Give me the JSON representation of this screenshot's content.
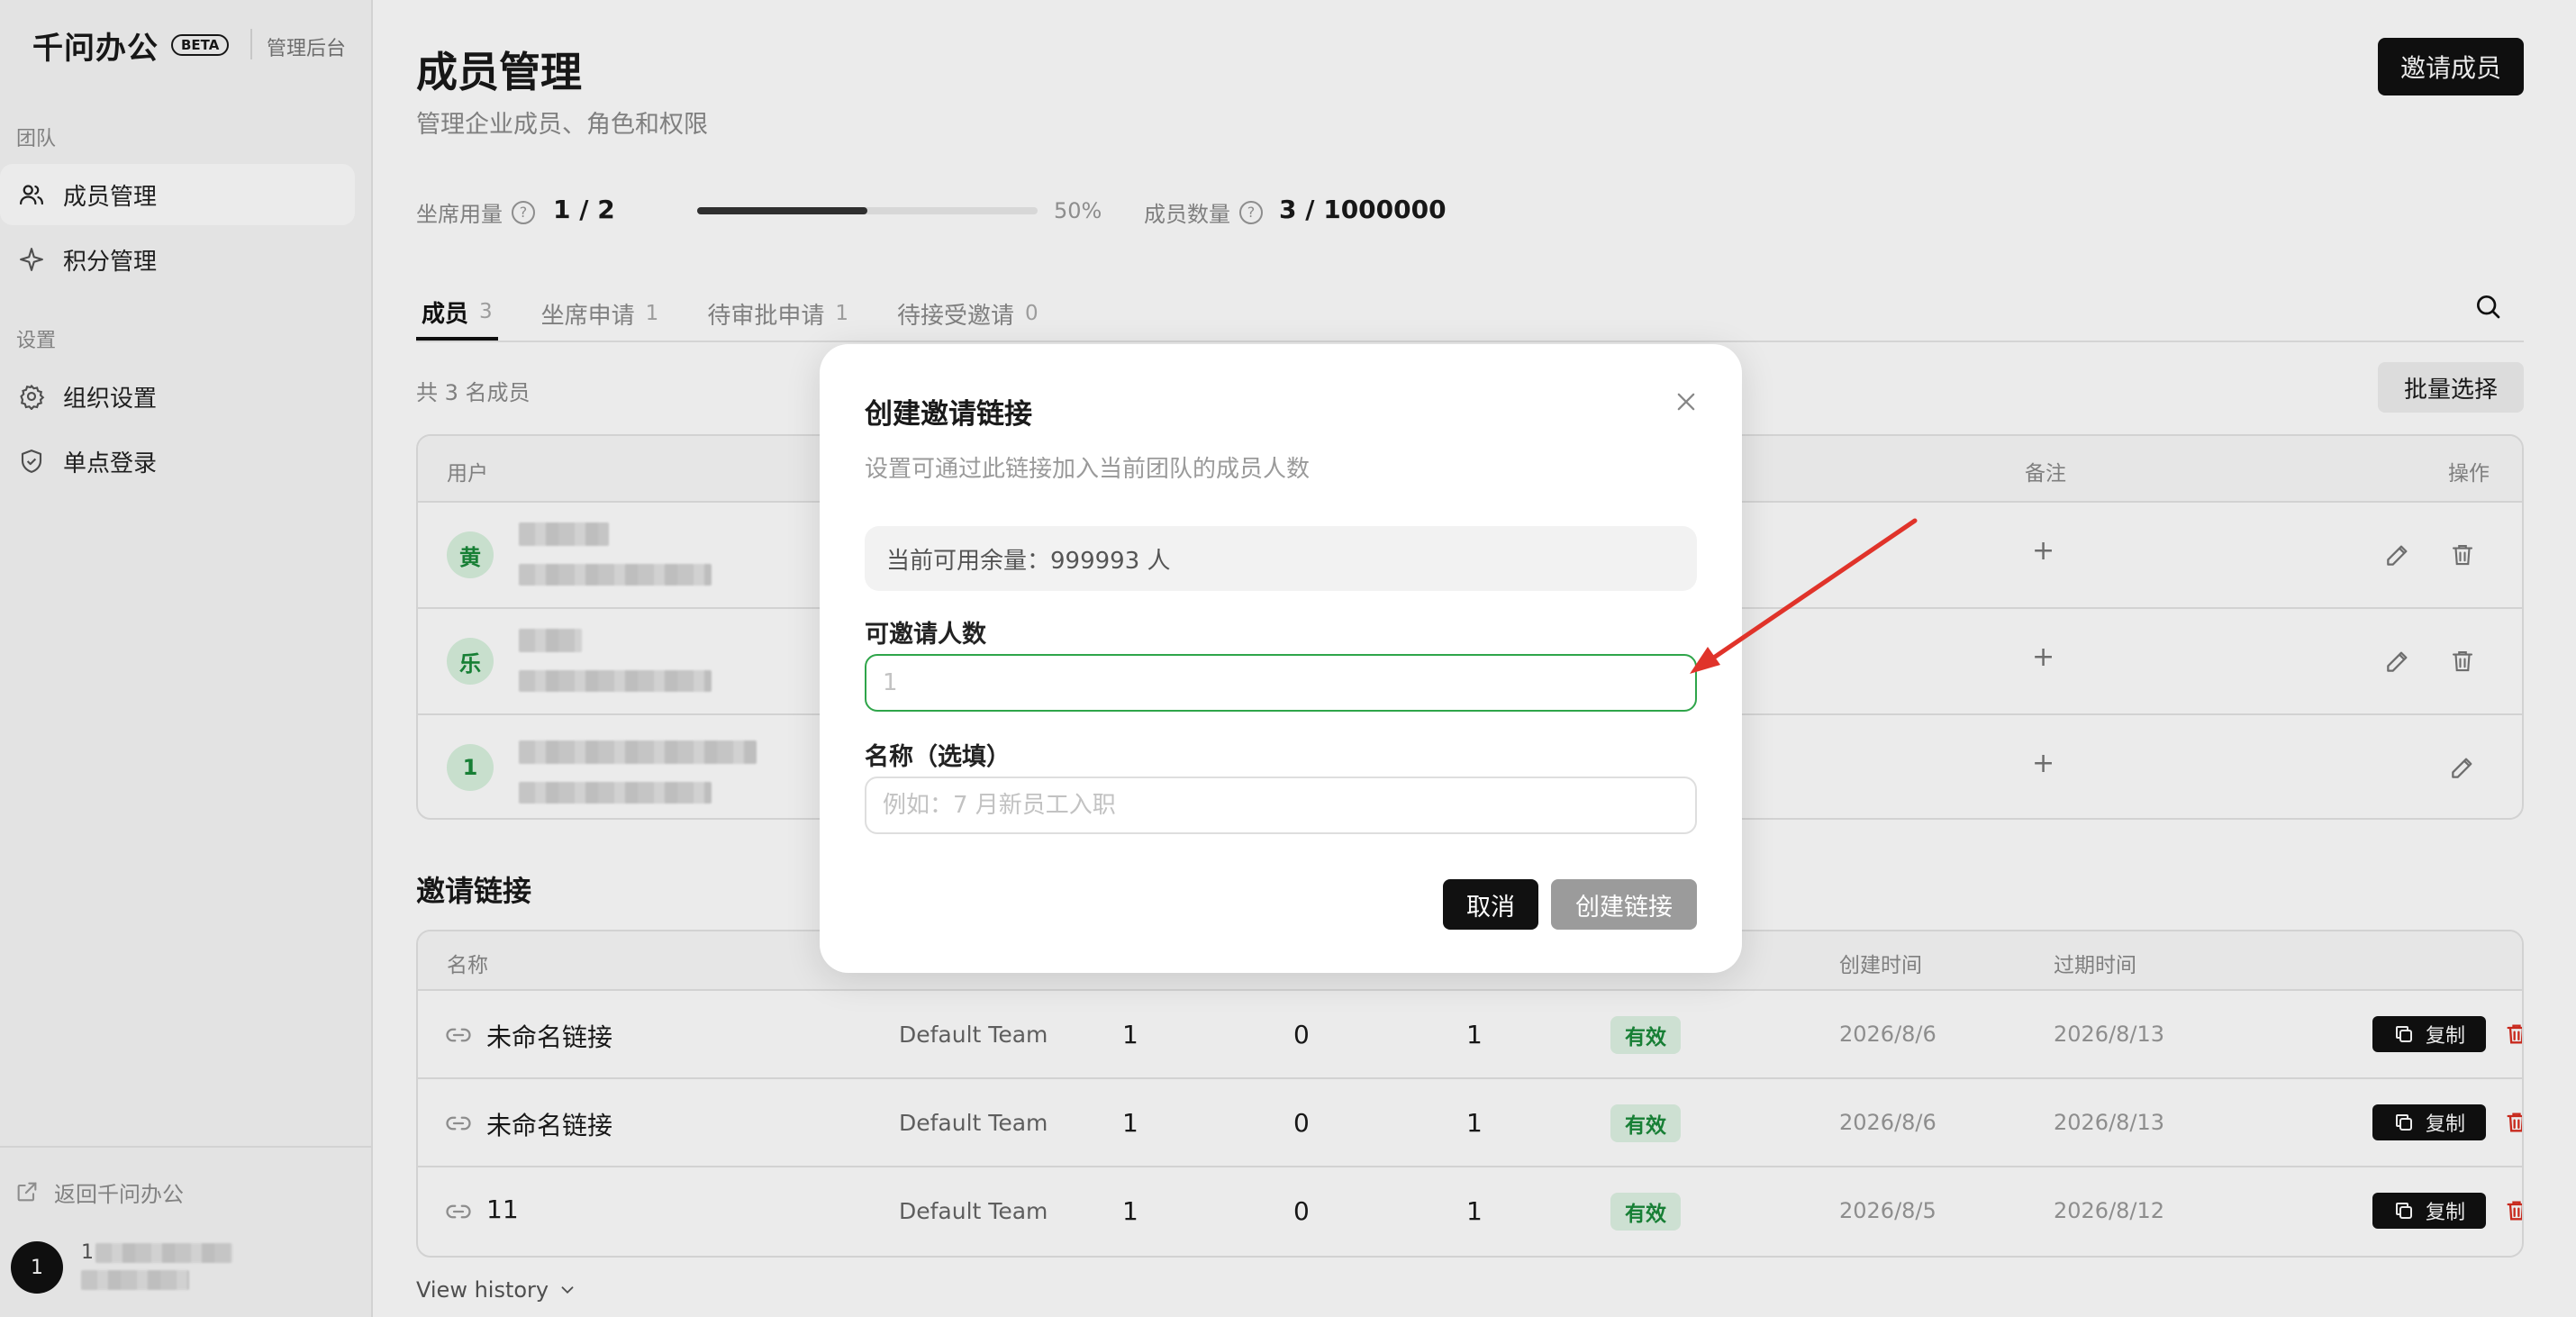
{
  "sidebar": {
    "brand": "千问办公",
    "beta": "BETA",
    "admin_label": "管理后台",
    "sections": [
      {
        "title": "团队",
        "items": [
          {
            "label": "成员管理",
            "icon": "users-icon",
            "active": true
          },
          {
            "label": "积分管理",
            "icon": "sparkle-icon",
            "active": false
          }
        ]
      },
      {
        "title": "设置",
        "items": [
          {
            "label": "组织设置",
            "icon": "gear-icon",
            "active": false
          },
          {
            "label": "单点登录",
            "icon": "shield-icon",
            "active": false
          }
        ]
      }
    ],
    "back_link": "返回千问办公",
    "user_avatar": "1",
    "user_name_visible": "1"
  },
  "header": {
    "title": "成员管理",
    "subtitle": "管理企业成员、角色和权限",
    "invite_button": "邀请成员"
  },
  "stats": {
    "seat_label": "坐席用量",
    "seat_value": "1 / 2",
    "seat_progress": 0.5,
    "seat_percent": "50%",
    "member_label": "成员数量",
    "member_value": "3 / 1000000"
  },
  "tabs": [
    {
      "label": "成员",
      "count": "3",
      "active": true
    },
    {
      "label": "坐席申请",
      "count": "1",
      "active": false
    },
    {
      "label": "待审批申请",
      "count": "1",
      "active": false
    },
    {
      "label": "待接受邀请",
      "count": "0",
      "active": false
    }
  ],
  "members": {
    "count_text": "共 3 名成员",
    "batch_button": "批量选择",
    "columns": {
      "user": "用户",
      "note": "备注",
      "actions": "操作"
    },
    "rows": [
      {
        "avatar": "黄",
        "note_add": "+"
      },
      {
        "avatar": "乐",
        "note_add": "+"
      },
      {
        "avatar": "1",
        "note_add": "+"
      }
    ]
  },
  "invite_links": {
    "title": "邀请链接",
    "columns": {
      "name": "名称",
      "created": "创建时间",
      "expires": "过期时间"
    },
    "rows": [
      {
        "name": "未命名链接",
        "team": "Default Team",
        "c1": "1",
        "c2": "0",
        "c3": "1",
        "status": "有效",
        "created": "2026/8/6",
        "expires": "2026/8/13",
        "copy": "复制"
      },
      {
        "name": "未命名链接",
        "team": "Default Team",
        "c1": "1",
        "c2": "0",
        "c3": "1",
        "status": "有效",
        "created": "2026/8/6",
        "expires": "2026/8/13",
        "copy": "复制"
      },
      {
        "name": "11",
        "team": "Default Team",
        "c1": "1",
        "c2": "0",
        "c3": "1",
        "status": "有效",
        "created": "2026/8/5",
        "expires": "2026/8/12",
        "copy": "复制"
      }
    ],
    "view_history": "View history"
  },
  "modal": {
    "title": "创建邀请链接",
    "description": "设置可通过此链接加入当前团队的成员人数",
    "quota_text": "当前可用余量：999993 人",
    "count_label": "可邀请人数",
    "count_placeholder": "1",
    "name_label": "名称（选填）",
    "name_placeholder": "例如：7 月新员工入职",
    "cancel": "取消",
    "create": "创建链接"
  },
  "colors": {
    "accent_dark": "#111111",
    "success_green": "#1a8a3a",
    "focus_border": "#2fa54a",
    "danger_red": "#d92d20",
    "annotation_arrow": "#e0332a"
  }
}
